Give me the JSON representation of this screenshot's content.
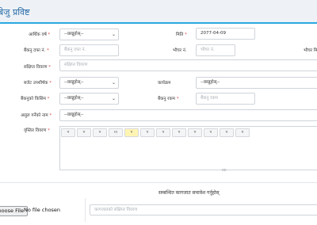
{
  "header": {
    "title": "बेजु प्रविष्ट"
  },
  "form": {
    "fiscal_year": {
      "label": "आर्थिक वर्ष",
      "value": "--छान्नुहोस्--"
    },
    "date": {
      "label": "मिति",
      "value": "2077-04-09"
    },
    "bank_voucher_no": {
      "label": "बैंकनु दफा नं.",
      "placeholder": "बैंकनु दफा नं."
    },
    "voucher_no": {
      "label": "भौचर नं.",
      "placeholder": "भौचर नं."
    },
    "voucher_right_label": "भौचर मिति",
    "short_description": {
      "label": "संक्षिप्त विवरण",
      "placeholder": "संक्षिप्त विवरण"
    },
    "budget_sub_head": {
      "label": "बजेट उपशीर्षक",
      "value": "--छान्नुहोस्--"
    },
    "program": {
      "label": "कार्यक्रम",
      "value": "--छान्नुहोस्--"
    },
    "bank_type": {
      "label": "बैंकनुको किसिम",
      "value": "--छान्नुहोस्--"
    },
    "bank_amount": {
      "label": "बैंकनु रकम",
      "placeholder": "बैंकनु रकम"
    },
    "auditor_name": {
      "label": "असुल गर्नेको नाम",
      "value": "--छान्नुहोस्--"
    },
    "detailed_description": {
      "label": "वृस्तित विवरण"
    }
  },
  "toolbar": {
    "buttons": [
      "ग",
      "ग",
      "ग",
      "१२",
      "ग",
      "ग",
      "ग",
      "ग",
      "ग",
      "ग",
      "ग",
      "ग"
    ]
  },
  "attachments": {
    "title": "सम्बन्धित कागजात समावेश गर्नुहोस्",
    "choose_file_label": "Choose File",
    "no_file_text": "No file chosen",
    "file_desc_placeholder": "कागजातको संक्षिप्त विवरण"
  },
  "colors": {
    "accent": "#29a8e0",
    "header_bg": "#eef2f7",
    "required": "#e0443e"
  }
}
